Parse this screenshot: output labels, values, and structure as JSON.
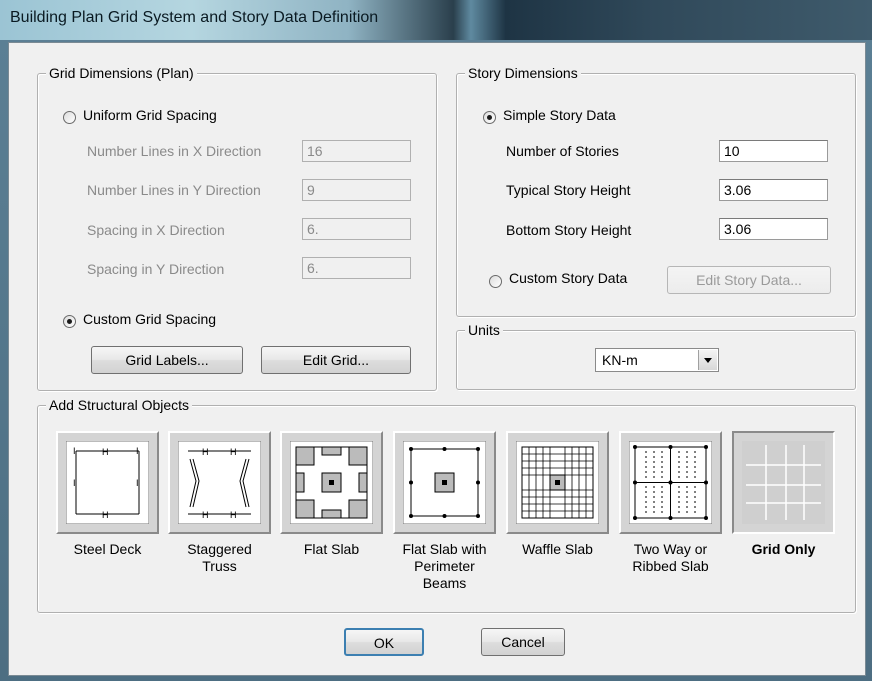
{
  "window": {
    "title": "Building Plan Grid System and Story Data Definition"
  },
  "grid_dimensions": {
    "legend": "Grid Dimensions (Plan)",
    "uniform_label": "Uniform Grid Spacing",
    "rows": [
      {
        "label": "Number Lines in X Direction",
        "value": "16"
      },
      {
        "label": "Number Lines in Y Direction",
        "value": "9"
      },
      {
        "label": "Spacing in X Direction",
        "value": "6."
      },
      {
        "label": "Spacing in Y Direction",
        "value": "6."
      }
    ],
    "custom_label": "Custom Grid Spacing",
    "grid_labels_button": "Grid Labels...",
    "edit_grid_button": "Edit Grid..."
  },
  "story_dimensions": {
    "legend": "Story Dimensions",
    "simple_label": "Simple Story Data",
    "rows": [
      {
        "label": "Number of Stories",
        "value": "10"
      },
      {
        "label": "Typical Story Height",
        "value": "3.06"
      },
      {
        "label": "Bottom Story Height",
        "value": "3.06"
      }
    ],
    "custom_label": "Custom Story Data",
    "edit_story_button": "Edit Story Data..."
  },
  "units": {
    "legend": "Units",
    "selected": "KN-m"
  },
  "structural_objects": {
    "legend": "Add Structural Objects",
    "items": [
      {
        "label_line1": "Steel Deck",
        "label_line2": "",
        "icon": "steel-deck-icon"
      },
      {
        "label_line1": "Staggered",
        "label_line2": "Truss",
        "icon": "staggered-truss-icon"
      },
      {
        "label_line1": "Flat Slab",
        "label_line2": "",
        "icon": "flat-slab-icon"
      },
      {
        "label_line1": "Flat Slab with",
        "label_line2": "Perimeter Beams",
        "icon": "flat-slab-perimeter-beams-icon"
      },
      {
        "label_line1": "Waffle Slab",
        "label_line2": "",
        "icon": "waffle-slab-icon"
      },
      {
        "label_line1": "Two Way or",
        "label_line2": "Ribbed Slab",
        "icon": "two-way-ribbed-slab-icon"
      },
      {
        "label_line1": "Grid Only",
        "label_line2": "",
        "icon": "grid-only-icon"
      }
    ]
  },
  "footer": {
    "ok_button": "OK",
    "cancel_button": "Cancel"
  }
}
